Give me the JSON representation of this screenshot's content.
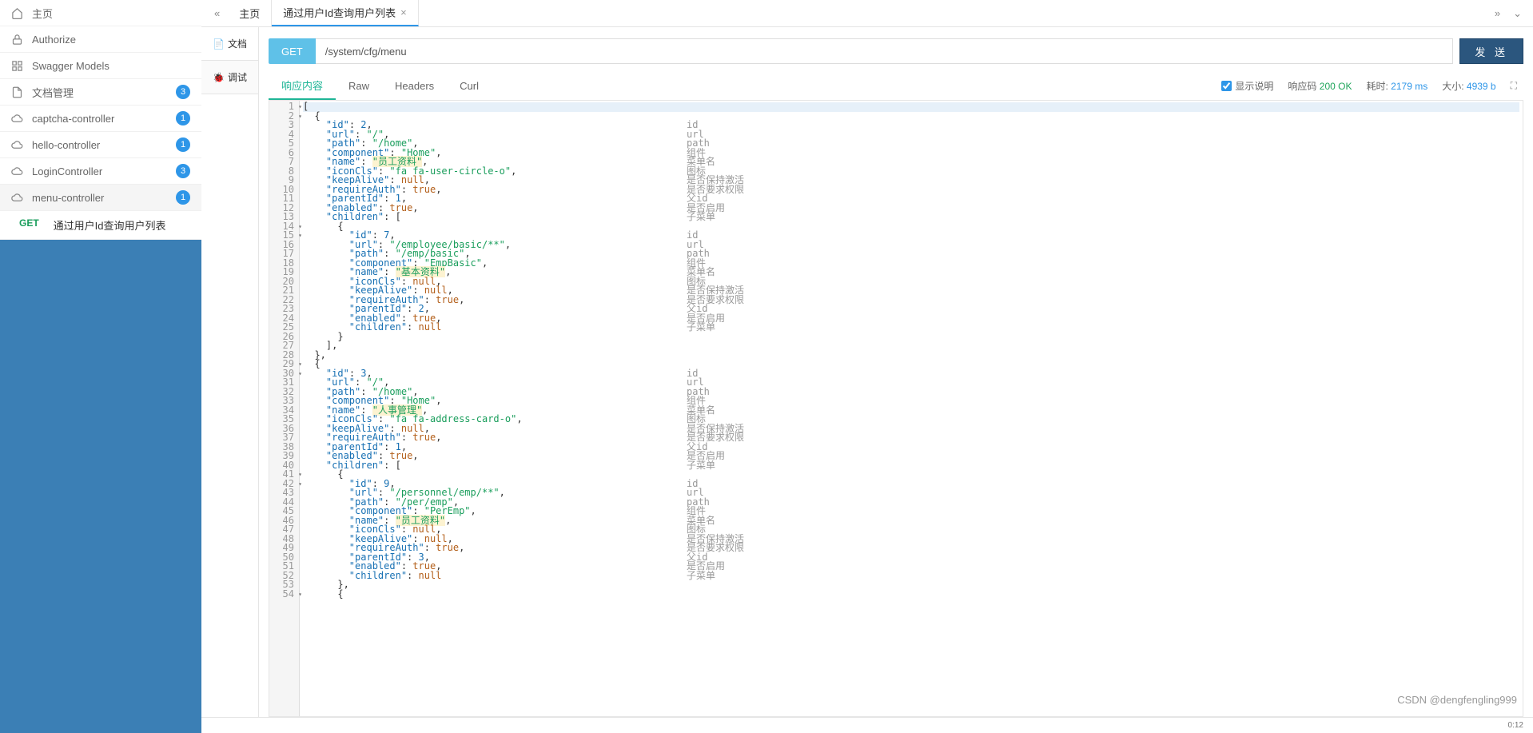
{
  "sidebar": {
    "items": [
      {
        "icon": "home",
        "label": "主页",
        "badge": null,
        "active": false
      },
      {
        "icon": "lock",
        "label": "Authorize",
        "badge": null,
        "active": false
      },
      {
        "icon": "grid",
        "label": "Swagger Models",
        "badge": null,
        "active": false
      },
      {
        "icon": "doc",
        "label": "文档管理",
        "badge": "3",
        "active": false
      },
      {
        "icon": "cloud",
        "label": "captcha-controller",
        "badge": "1",
        "active": false
      },
      {
        "icon": "cloud",
        "label": "hello-controller",
        "badge": "1",
        "active": false
      },
      {
        "icon": "cloud",
        "label": "LoginController",
        "badge": "3",
        "active": false
      },
      {
        "icon": "cloud",
        "label": "menu-controller",
        "badge": "1",
        "active": true
      }
    ],
    "sub": {
      "method": "GET",
      "label": "通过用户Id查询用户列表"
    }
  },
  "tabs": {
    "list": [
      {
        "label": "主页",
        "closable": false,
        "active": false
      },
      {
        "label": "通过用户Id查询用户列表",
        "closable": true,
        "active": true
      }
    ]
  },
  "leftpanel": {
    "doc": "文档",
    "debug": "调试"
  },
  "request": {
    "method": "GET",
    "url": "/system/cfg/menu",
    "send": "发 送"
  },
  "response": {
    "tabs": {
      "body": "响应内容",
      "raw": "Raw",
      "headers": "Headers",
      "curl": "Curl"
    },
    "showDesc": "显示说明",
    "statusLabel": "响应码",
    "status": "200 OK",
    "timeLabel": "耗时:",
    "time": "2179 ms",
    "sizeLabel": "大小:",
    "size": "4939 b"
  },
  "code": {
    "totalLines": 54,
    "foldLines": [
      1,
      2,
      14,
      15,
      29,
      30,
      41,
      42,
      54
    ],
    "lines": [
      "[",
      "  {",
      "    \"id\": 2,",
      "    \"url\": \"/\",",
      "    \"path\": \"/home\",",
      "    \"component\": \"Home\",",
      "    \"name\": \"员工资料\",",
      "    \"iconCls\": \"fa fa-user-circle-o\",",
      "    \"keepAlive\": null,",
      "    \"requireAuth\": true,",
      "    \"parentId\": 1,",
      "    \"enabled\": true,",
      "    \"children\": [",
      "      {",
      "        \"id\": 7,",
      "        \"url\": \"/employee/basic/**\",",
      "        \"path\": \"/emp/basic\",",
      "        \"component\": \"EmpBasic\",",
      "        \"name\": \"基本资料\",",
      "        \"iconCls\": null,",
      "        \"keepAlive\": null,",
      "        \"requireAuth\": true,",
      "        \"parentId\": 2,",
      "        \"enabled\": true,",
      "        \"children\": null",
      "      }",
      "    ],",
      "  },",
      "  {",
      "    \"id\": 3,",
      "    \"url\": \"/\",",
      "    \"path\": \"/home\",",
      "    \"component\": \"Home\",",
      "    \"name\": \"人事管理\",",
      "    \"iconCls\": \"fa fa-address-card-o\",",
      "    \"keepAlive\": null,",
      "    \"requireAuth\": true,",
      "    \"parentId\": 1,",
      "    \"enabled\": true,",
      "    \"children\": [",
      "      {",
      "        \"id\": 9,",
      "        \"url\": \"/personnel/emp/**\",",
      "        \"path\": \"/per/emp\",",
      "        \"component\": \"PerEmp\",",
      "        \"name\": \"员工资料\",",
      "        \"iconCls\": null,",
      "        \"keepAlive\": null,",
      "        \"requireAuth\": true,",
      "        \"parentId\": 3,",
      "        \"enabled\": true,",
      "        \"children\": null",
      "      },",
      "      {"
    ],
    "highlightNames": [
      "员工资料",
      "基本资料",
      "人事管理",
      "员工资料"
    ],
    "comments": [
      "",
      "",
      "id",
      "url",
      "path",
      "组件",
      "菜单名",
      "图标",
      "是否保持激活",
      "是否要求权限",
      "父id",
      "是否启用",
      "子菜单",
      "",
      "id",
      "url",
      "path",
      "组件",
      "菜单名",
      "图标",
      "是否保持激活",
      "是否要求权限",
      "父id",
      "是否启用",
      "子菜单",
      "",
      "",
      "",
      "",
      "id",
      "url",
      "path",
      "组件",
      "菜单名",
      "图标",
      "是否保持激活",
      "是否要求权限",
      "父id",
      "是否启用",
      "子菜单",
      "",
      "id",
      "url",
      "path",
      "组件",
      "菜单名",
      "图标",
      "是否保持激活",
      "是否要求权限",
      "父id",
      "是否启用",
      "子菜单",
      "",
      ""
    ]
  },
  "watermark": "CSDN @dengfengling999",
  "bottime": "0:12"
}
